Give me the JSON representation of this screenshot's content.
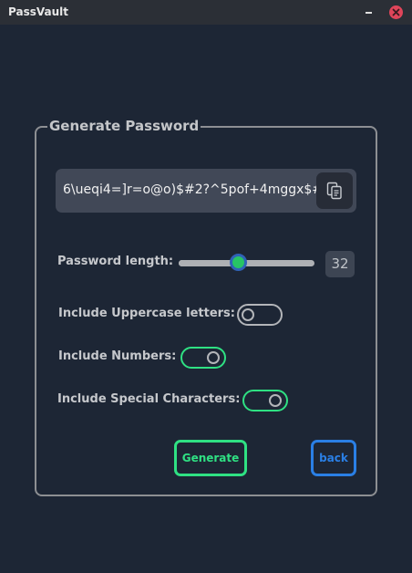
{
  "window": {
    "title": "PassVault"
  },
  "group": {
    "title": "Generate Password"
  },
  "password": {
    "value": "6\\ueqi4=]r=o@o)$#2?^5pof+4mggx$#"
  },
  "length": {
    "label": "Password length:",
    "value": "32",
    "slider_fraction": 0.44
  },
  "options": [
    {
      "label": "Include Uppercase letters:",
      "enabled": false
    },
    {
      "label": "Include Numbers:",
      "enabled": true
    },
    {
      "label": "Include Special Characters:",
      "enabled": true
    }
  ],
  "buttons": {
    "generate_label": "Generate",
    "back_label": "back"
  },
  "colors": {
    "accent_green": "#2fe183",
    "accent_blue": "#2a7fe5",
    "background": "#1d2635"
  }
}
